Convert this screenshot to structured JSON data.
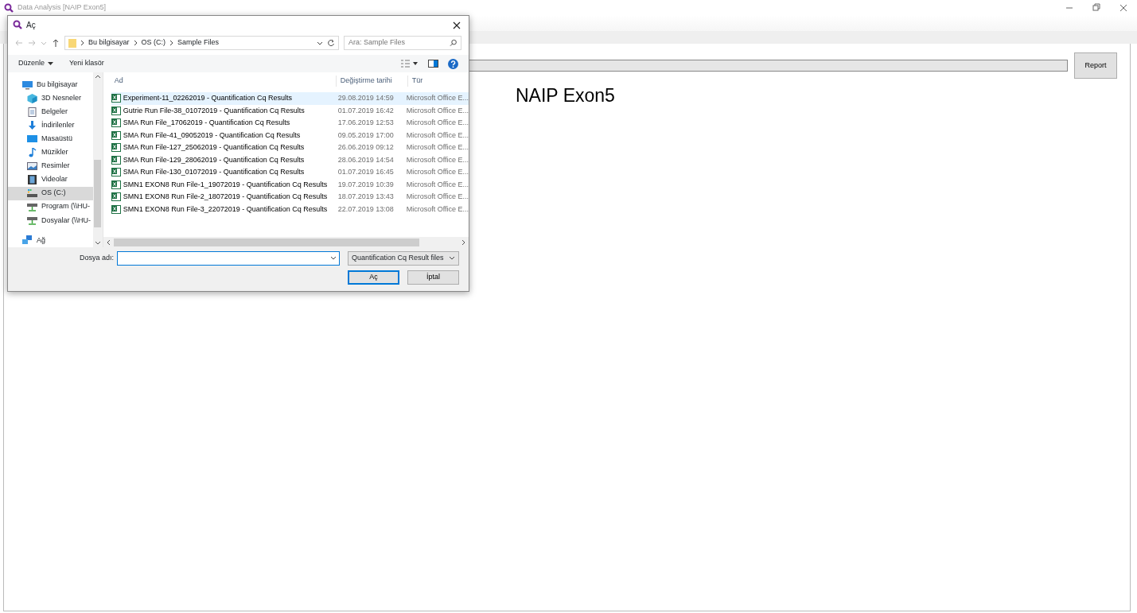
{
  "window": {
    "title": "Data Analysis [NAIP Exon5]"
  },
  "main": {
    "progress": {
      "level": 0
    },
    "report_button": "Report",
    "heading": "NAIP Exon5"
  },
  "dialog": {
    "title": "Aç",
    "breadcrumb": [
      "Bu bilgisayar",
      "OS (C:)",
      "Sample Files"
    ],
    "search": {
      "placeholder": "Ara: Sample Files"
    },
    "toolbar": [
      "Düzenle",
      "Yeni klasör"
    ],
    "sidebar": [
      {
        "label": "Bu bilgisayar",
        "kind": "pc",
        "selected": false,
        "children": [
          {
            "label": "3D Nesneler",
            "kind": "cube",
            "selected": false
          },
          {
            "label": "Belgeler",
            "kind": "docs",
            "selected": false
          },
          {
            "label": "İndirilenler",
            "kind": "download",
            "selected": false
          },
          {
            "label": "Masaüstü",
            "kind": "desktop",
            "selected": false
          },
          {
            "label": "Müzikler",
            "kind": "music",
            "selected": false
          },
          {
            "label": "Resimler",
            "kind": "pictures",
            "selected": false
          },
          {
            "label": "Videolar",
            "kind": "videos",
            "selected": false
          },
          {
            "label": "OS (C:)",
            "kind": "drive",
            "selected": true
          },
          {
            "label": "Program (\\\\HU-",
            "kind": "netdrive",
            "selected": false
          },
          {
            "label": "Dosyalar (\\\\HU-",
            "kind": "netdrive",
            "selected": false
          }
        ]
      },
      {
        "label": "Ağ",
        "kind": "network",
        "selected": false
      }
    ],
    "columns": [
      "Ad",
      "Değiştirme tarihi",
      "Tür"
    ],
    "rows": [
      {
        "name": "Experiment-11_02262019 -  Quantification Cq Results",
        "date": "29.08.2019 14:59",
        "type": "Microsoft Office E...",
        "selected": true
      },
      {
        "name": "Gutrie Run File-38_01072019 -  Quantification Cq Results",
        "date": "01.07.2019 16:42",
        "type": "Microsoft Office E...",
        "selected": false
      },
      {
        "name": "SMA Run File_17062019 -  Quantification Cq Results",
        "date": "17.06.2019 12:53",
        "type": "Microsoft Office E...",
        "selected": false
      },
      {
        "name": "SMA Run File-41_09052019 -  Quantification Cq Results",
        "date": "09.05.2019 17:00",
        "type": "Microsoft Office E...",
        "selected": false
      },
      {
        "name": "SMA Run File-127_25062019 -  Quantification Cq Results",
        "date": "26.06.2019 09:12",
        "type": "Microsoft Office E...",
        "selected": false
      },
      {
        "name": "SMA Run File-129_28062019 -  Quantification Cq Results",
        "date": "28.06.2019 14:54",
        "type": "Microsoft Office E...",
        "selected": false
      },
      {
        "name": "SMA Run File-130_01072019 -  Quantification Cq Results",
        "date": "01.07.2019 16:45",
        "type": "Microsoft Office E...",
        "selected": false
      },
      {
        "name": "SMN1 EXON8 Run File-1_19072019 -  Quantification Cq Results",
        "date": "19.07.2019 10:39",
        "type": "Microsoft Office E...",
        "selected": false
      },
      {
        "name": "SMN1 EXON8 Run File-2_18072019 -  Quantification Cq Results",
        "date": "18.07.2019 13:43",
        "type": "Microsoft Office E...",
        "selected": false
      },
      {
        "name": "SMN1 EXON8 Run File-3_22072019 -  Quantification Cq Results",
        "date": "22.07.2019 13:08",
        "type": "Microsoft Office E...",
        "selected": false
      }
    ],
    "file_name": {
      "label": "Dosya adı:"
    },
    "filter": "Quantification Cq Result files",
    "buttons": [
      "Aç",
      "İptal"
    ]
  }
}
